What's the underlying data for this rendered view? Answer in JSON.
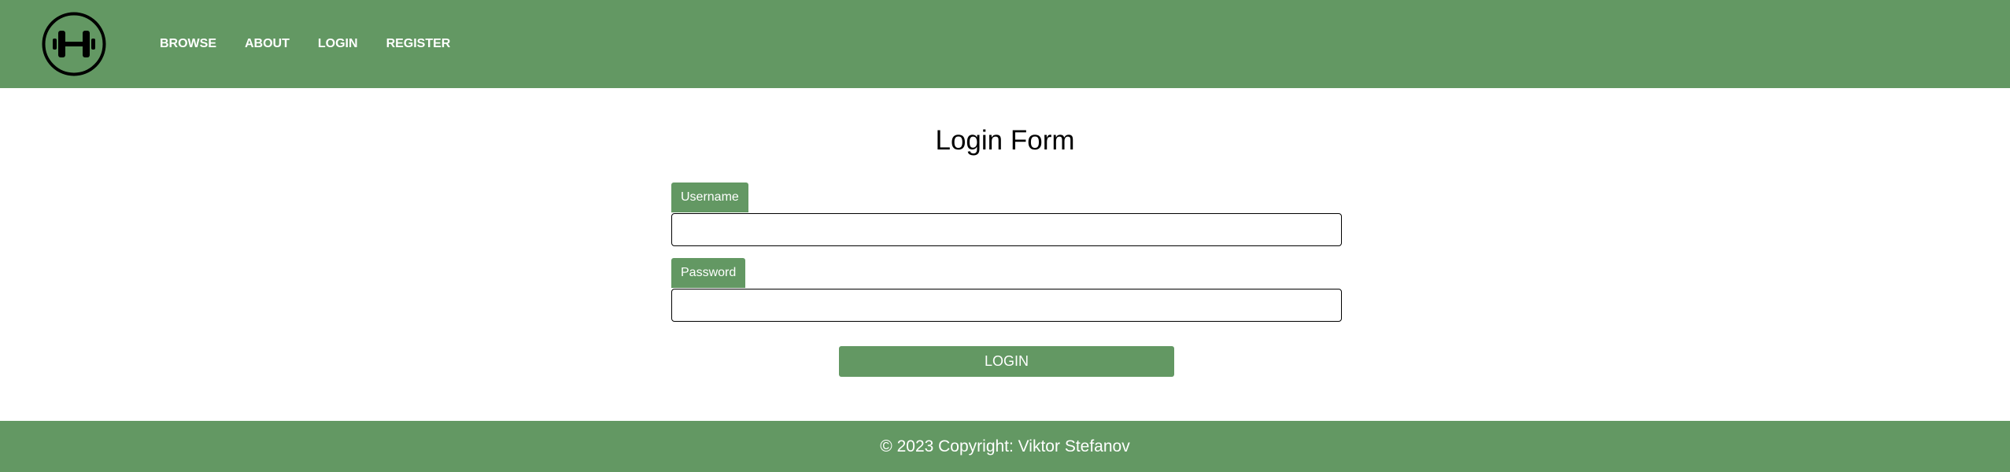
{
  "navbar": {
    "logo_icon": "dumbbell-icon",
    "background": "#639863",
    "links": [
      "BROWSE",
      "ABOUT",
      "LOGIN",
      "REGISTER"
    ]
  },
  "form": {
    "title": "Login Form",
    "username_label": "Username",
    "username_value": "",
    "password_label": "Password",
    "password_value": "",
    "submit_label": "LOGIN"
  },
  "footer": {
    "text": "© 2023 Copyright: Viktor Stefanov"
  }
}
